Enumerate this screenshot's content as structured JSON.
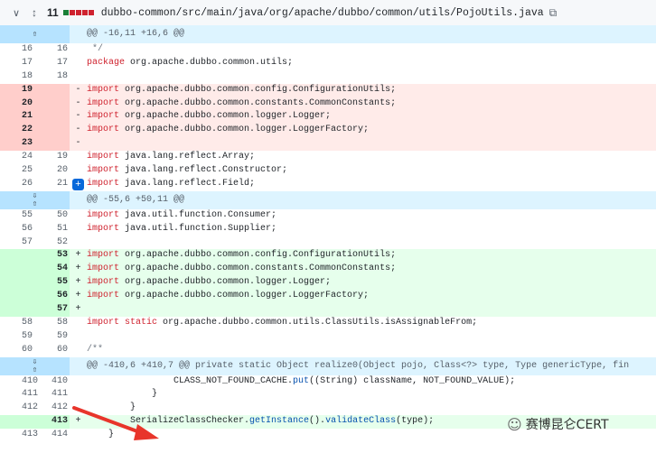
{
  "header": {
    "collapse_icon": "chevron-down-icon",
    "expand_icon": "expand-icon",
    "change_count": "11",
    "blocks": [
      "#1a7f37",
      "#cf222e",
      "#cf222e",
      "#cf222e",
      "#cf222e"
    ],
    "path": "dubbo-common/src/main/java/org/apache/dubbo/common/utils/PojoUtils.java",
    "copy_icon": "copy-icon"
  },
  "hunks": [
    "@@ -16,11 +16,6 @@",
    "@@ -55,6 +50,11 @@",
    "@@ -410,6 +410,7 @@ private static Object realize0(Object pojo, Class<?> type, Type genericType, fin"
  ],
  "lines": [
    {
      "old": "16",
      "new": "16",
      "sign": "",
      "text": " */"
    },
    {
      "old": "17",
      "new": "17",
      "sign": "",
      "text": "package org.apache.dubbo.common.utils;"
    },
    {
      "old": "18",
      "new": "18",
      "sign": "",
      "text": ""
    },
    {
      "old": "19",
      "new": "",
      "sign": "-",
      "text": "import org.apache.dubbo.common.config.ConfigurationUtils;"
    },
    {
      "old": "20",
      "new": "",
      "sign": "-",
      "text": "import org.apache.dubbo.common.constants.CommonConstants;"
    },
    {
      "old": "21",
      "new": "",
      "sign": "-",
      "text": "import org.apache.dubbo.common.logger.Logger;"
    },
    {
      "old": "22",
      "new": "",
      "sign": "-",
      "text": "import org.apache.dubbo.common.logger.LoggerFactory;"
    },
    {
      "old": "23",
      "new": "",
      "sign": "-",
      "text": ""
    },
    {
      "old": "24",
      "new": "19",
      "sign": "",
      "text": "import java.lang.reflect.Array;"
    },
    {
      "old": "25",
      "new": "20",
      "sign": "",
      "text": "import java.lang.reflect.Constructor;"
    },
    {
      "old": "26",
      "new": "21",
      "sign": "",
      "text": "import java.lang.reflect.Field;"
    },
    {
      "old": "55",
      "new": "50",
      "sign": "",
      "text": "import java.util.function.Consumer;"
    },
    {
      "old": "56",
      "new": "51",
      "sign": "",
      "text": "import java.util.function.Supplier;"
    },
    {
      "old": "57",
      "new": "52",
      "sign": "",
      "text": ""
    },
    {
      "old": "",
      "new": "53",
      "sign": "+",
      "text": "import org.apache.dubbo.common.config.ConfigurationUtils;"
    },
    {
      "old": "",
      "new": "54",
      "sign": "+",
      "text": "import org.apache.dubbo.common.constants.CommonConstants;"
    },
    {
      "old": "",
      "new": "55",
      "sign": "+",
      "text": "import org.apache.dubbo.common.logger.Logger;"
    },
    {
      "old": "",
      "new": "56",
      "sign": "+",
      "text": "import org.apache.dubbo.common.logger.LoggerFactory;"
    },
    {
      "old": "",
      "new": "57",
      "sign": "+",
      "text": ""
    },
    {
      "old": "58",
      "new": "58",
      "sign": "",
      "text": "import static org.apache.dubbo.common.utils.ClassUtils.isAssignableFrom;"
    },
    {
      "old": "59",
      "new": "59",
      "sign": "",
      "text": ""
    },
    {
      "old": "60",
      "new": "60",
      "sign": "",
      "text": "/**"
    },
    {
      "old": "410",
      "new": "410",
      "sign": "",
      "text": "                CLASS_NOT_FOUND_CACHE.put((String) className, NOT_FOUND_VALUE);"
    },
    {
      "old": "411",
      "new": "411",
      "sign": "",
      "text": "            }"
    },
    {
      "old": "412",
      "new": "412",
      "sign": "",
      "text": "        }"
    },
    {
      "old": "",
      "new": "413",
      "sign": "+",
      "text": "        SerializeClassChecker.getInstance().validateClass(type);"
    },
    {
      "old": "413",
      "new": "414",
      "sign": "",
      "text": "    }"
    }
  ],
  "add_comment_label": "+",
  "watermark": "赛博昆仑CERT",
  "colors": {
    "arrow": "#e8352b",
    "hunk_bg": "#ddf4ff",
    "del_bg": "#ffebe9",
    "add_bg": "#e6ffec"
  }
}
